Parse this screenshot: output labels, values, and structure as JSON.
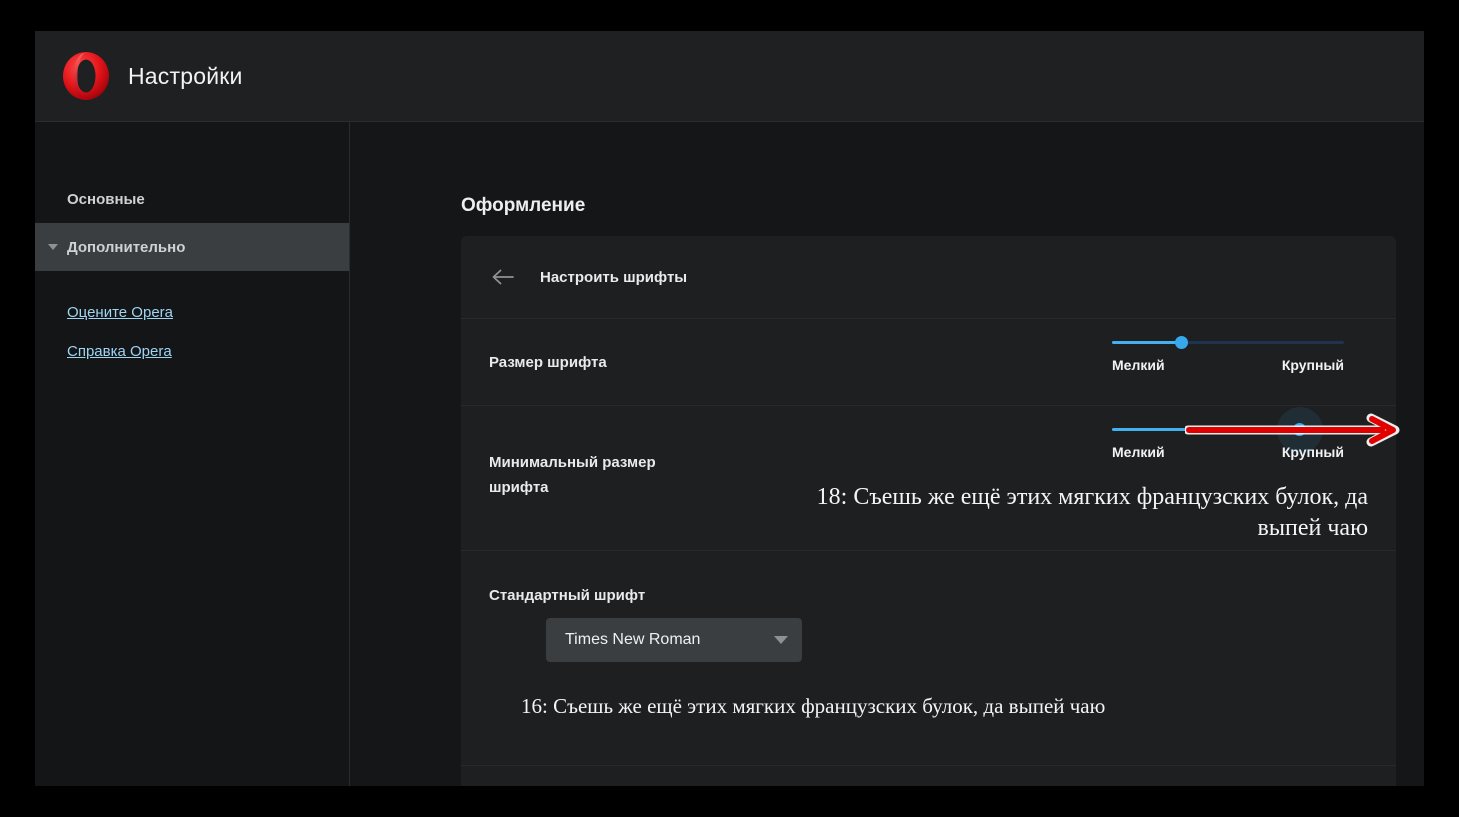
{
  "window": {
    "header": {
      "logo_icon": "opera-logo-icon",
      "title": "Настройки"
    }
  },
  "sidebar": {
    "items": [
      {
        "label": "Основные",
        "selected": false,
        "has_caret": false
      },
      {
        "label": "Дополнительно",
        "selected": true,
        "has_caret": true
      }
    ],
    "links": [
      {
        "label": "Оцените Opera"
      },
      {
        "label": "Справка Opera"
      }
    ]
  },
  "main": {
    "section_title": "Оформление",
    "card": {
      "back_icon": "back-arrow-icon",
      "title": "Настроить шрифты",
      "rows": [
        {
          "label": "Размер шрифта",
          "slider": {
            "min_label": "Мелкий",
            "max_label": "Крупный",
            "value_percent": 30
          }
        },
        {
          "label": "Минимальный размер шрифта",
          "slider": {
            "min_label": "Мелкий",
            "max_label": "Крупный",
            "value_percent": 81
          },
          "sample": "18: Съешь же ещё этих мягких французских булок, да выпей чаю"
        },
        {
          "label": "Стандартный шрифт",
          "dropdown": {
            "value": "Times New Roman",
            "caret_icon": "chevron-down-icon"
          },
          "sample": "16: Съешь же ещё этих мягких французских булок, да выпей чаю"
        }
      ]
    }
  },
  "annotation": {
    "arrow_icon": "red-arrow-right-icon",
    "color": "#e00000"
  },
  "cursor": {
    "icon": "mouse-pointer-icon"
  },
  "colors": {
    "page_background": "#151719",
    "header_background": "#1e2022",
    "sidebar_background": "#131517",
    "card_background": "#1d1f21",
    "selected_nav": "#3b3e41",
    "link": "#9fd4f3",
    "slider_accent": "#44b0f0",
    "slider_track": "#1e3350",
    "dropdown_background": "#3b3e41",
    "opera_red": "#e3000f"
  }
}
